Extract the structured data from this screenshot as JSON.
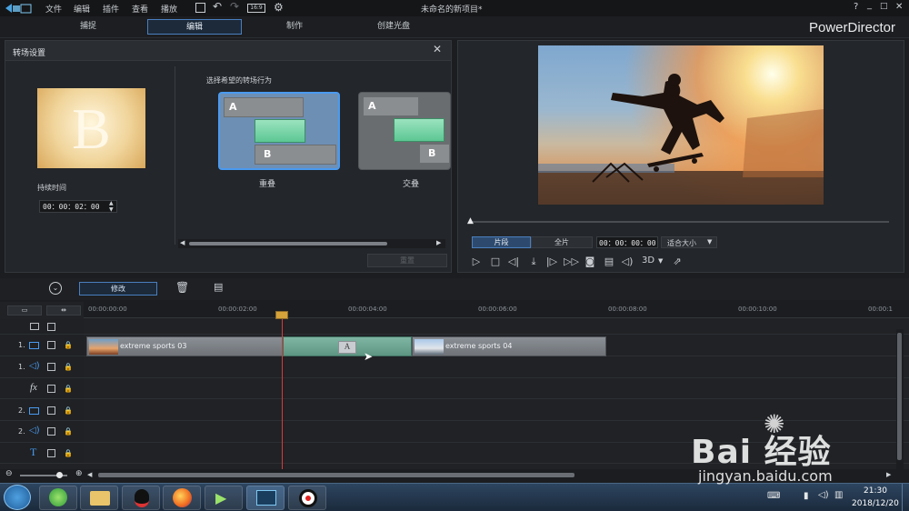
{
  "app": {
    "window_title": "未命名的新项目*",
    "brand": "PowerDirector",
    "menu": [
      "文件",
      "编辑",
      "插件",
      "查看",
      "播放"
    ],
    "window_controls": [
      "?",
      "_",
      "□",
      "✕"
    ]
  },
  "tabs": [
    {
      "label": "捕捉",
      "active": false
    },
    {
      "label": "编辑",
      "active": true
    },
    {
      "label": "制作",
      "active": false
    },
    {
      "label": "创建光盘",
      "active": false
    }
  ],
  "transition_panel": {
    "title": "转场设置",
    "preview_letter": "B",
    "duration_label": "持续时间",
    "duration_value": "00：00：02：00",
    "behavior_label": "选择希望的转场行为",
    "options": [
      {
        "label": "重叠",
        "top": "A",
        "bottom": "B",
        "selected": true
      },
      {
        "label": "交叠",
        "top": "A",
        "bottom": "B",
        "selected": false
      }
    ],
    "reset_label": "重置"
  },
  "preview": {
    "mode_clip": "片段",
    "mode_movie": "全片",
    "timecode": "00：00：00：00",
    "fit_label": "适合大小",
    "threed_label": "3D"
  },
  "toolbar": {
    "modify_label": "修改"
  },
  "timeline": {
    "ruler": [
      "00:00:00:00",
      "00:00:02:00",
      "00:00:04:00",
      "00:00:06:00",
      "00:00:08:00",
      "00:00:10:00",
      "00:00:1"
    ],
    "tracks": [
      {
        "id": "1.",
        "type": "video"
      },
      {
        "id": "1.",
        "type": "audio"
      },
      {
        "id": "",
        "type": "fx",
        "symbol": "fx"
      },
      {
        "id": "2.",
        "type": "video"
      },
      {
        "id": "2.",
        "type": "audio"
      },
      {
        "id": "",
        "type": "title",
        "symbol": "T"
      }
    ],
    "clips": [
      {
        "label": "extreme sports 03"
      },
      {
        "label": "A",
        "kind": "transition"
      },
      {
        "label": "extreme sports 04"
      }
    ]
  },
  "taskbar": {
    "time": "21:30",
    "date": "2018/12/20"
  },
  "watermark": {
    "main": "Bai 经验",
    "sub": "jingyan.baidu.com"
  },
  "colors": {
    "accent": "#4a7fbf",
    "transition_green": "#5cc793",
    "playhead": "#d93a3a"
  }
}
